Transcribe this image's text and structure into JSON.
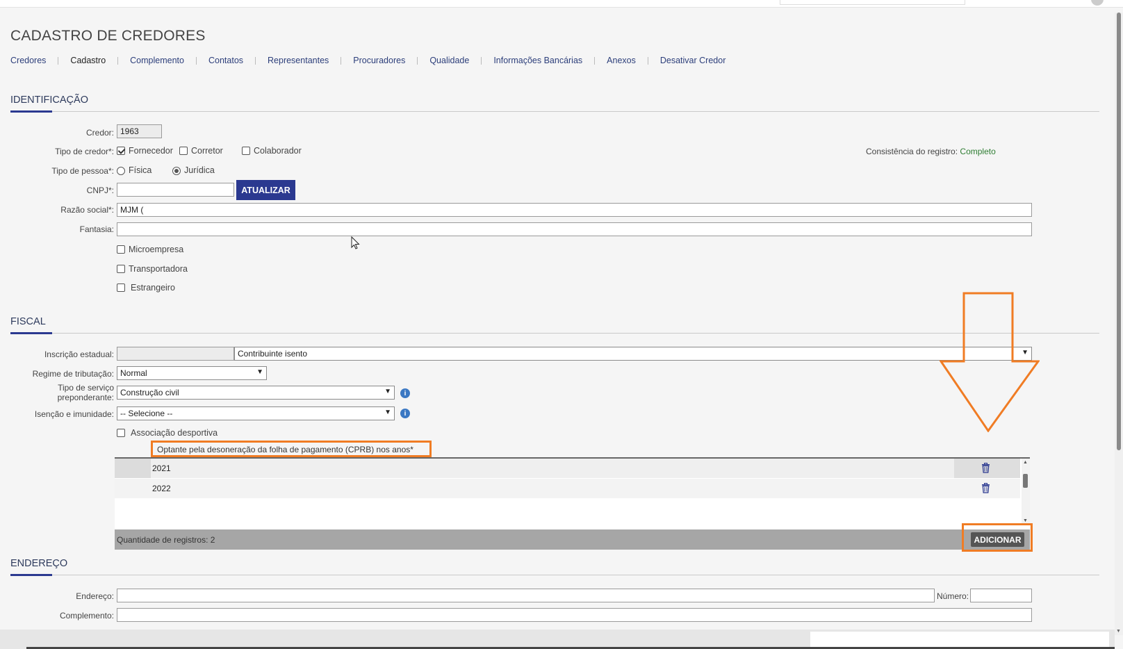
{
  "page": {
    "title": "CADASTRO DE CREDORES"
  },
  "tabs": [
    {
      "label": "Credores"
    },
    {
      "label": "Cadastro"
    },
    {
      "label": "Complemento"
    },
    {
      "label": "Contatos"
    },
    {
      "label": "Representantes"
    },
    {
      "label": "Procuradores"
    },
    {
      "label": "Qualidade"
    },
    {
      "label": "Informações Bancárias"
    },
    {
      "label": "Anexos"
    },
    {
      "label": "Desativar Credor"
    }
  ],
  "identificacao": {
    "title": "IDENTIFICAÇÃO",
    "credor_label": "Credor:",
    "credor_value": "1963",
    "tipo_credor_label": "Tipo de credor*:",
    "tipo_credor_options": [
      {
        "label": "Fornecedor",
        "checked": true
      },
      {
        "label": "Corretor",
        "checked": false
      },
      {
        "label": "Colaborador",
        "checked": false
      }
    ],
    "tipo_pessoa_label": "Tipo de pessoa*:",
    "tipo_pessoa_options": [
      {
        "label": "Física",
        "checked": false
      },
      {
        "label": "Jurídica",
        "checked": true
      }
    ],
    "cnpj_label": "CNPJ*:",
    "cnpj_value": "",
    "atualizar_label": "ATUALIZAR",
    "razao_social_label": "Razão social*:",
    "razao_social_value": "MJM (",
    "fantasia_label": "Fantasia:",
    "fantasia_value": "",
    "flags": [
      {
        "label": "Microempresa",
        "checked": false
      },
      {
        "label": "Transportadora",
        "checked": false
      },
      {
        "label": "Estrangeiro",
        "checked": false
      }
    ],
    "consistencia_label": "Consistência do registro:",
    "consistencia_value": "Completo",
    "consistencia_color": "#2e7d32"
  },
  "fiscal": {
    "title": "FISCAL",
    "inscricao_label": "Inscrição estadual:",
    "inscricao_value": "",
    "inscricao_select": "Contribuinte isento",
    "regime_label": "Regime de tributação:",
    "regime_value": "Normal",
    "tipo_servico_label_1": "Tipo de serviço",
    "tipo_servico_label_2": "preponderante:",
    "tipo_servico_value": "Construção civil",
    "isencao_label": "Isenção e imunidade:",
    "isencao_value": "-- Selecione --",
    "associacao_label": "Associação desportiva",
    "associacao_checked": false,
    "cprb_label": "Optante pela desoneração da folha de pagamento (CPRB) nos anos*",
    "grid_rows": [
      {
        "year": "2021"
      },
      {
        "year": "2022"
      }
    ],
    "records_count": "Quantidade de registros: 2",
    "adicionar_label": "ADICIONAR"
  },
  "endereco": {
    "title": "ENDEREÇO",
    "endereco_label": "Endereço:",
    "endereco_value": "",
    "numero_label": "Número:",
    "numero_value": "",
    "complemento_label": "Complemento:",
    "complemento_value": ""
  },
  "colors": {
    "accent": "#2b3990",
    "highlight": "#f07c24"
  },
  "icons": {
    "info": "info-icon",
    "trash": "trash-icon",
    "arrow": "arrow-down-annotation-icon"
  }
}
